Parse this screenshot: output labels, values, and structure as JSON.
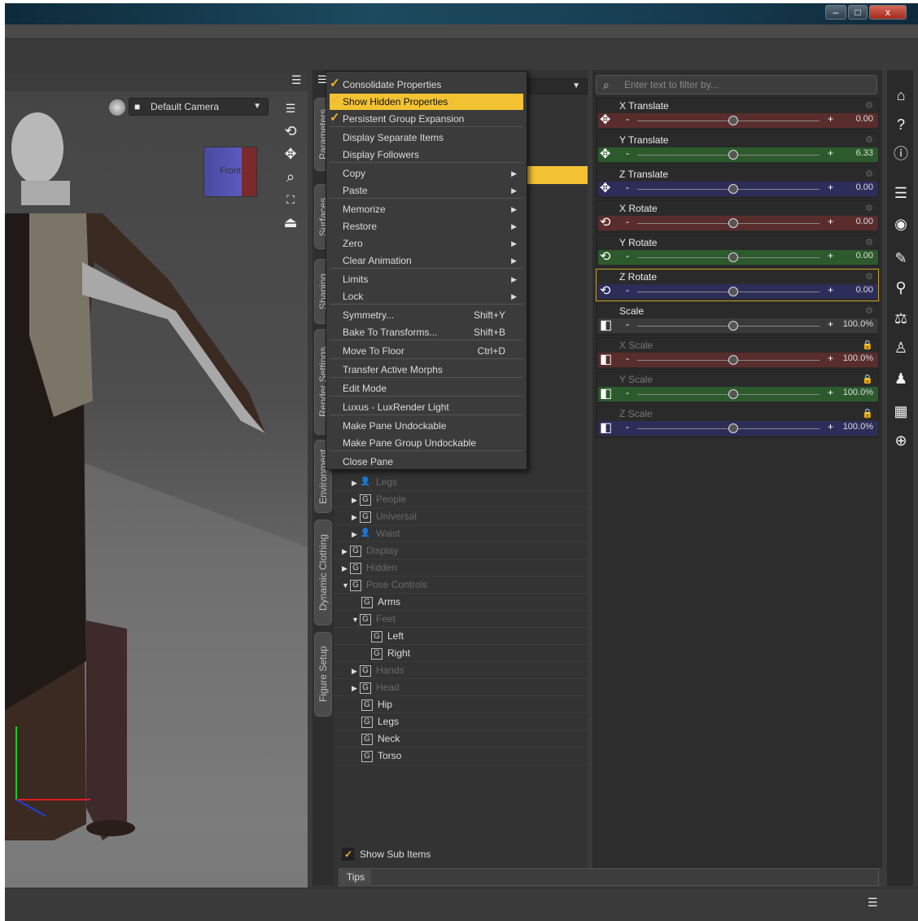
{
  "window": {
    "minimize": "–",
    "maximize": "□",
    "close": "x"
  },
  "viewport": {
    "camera_label": "Default Camera",
    "cube_face": "Front"
  },
  "side_tabs": [
    "Parameters",
    "Surfaces",
    "Shaping",
    "Render Settings",
    "Environment",
    "Dynamic Clothing",
    "Figure Setup"
  ],
  "context_menu": {
    "items": [
      {
        "label": "Consolidate Properties",
        "checked": true
      },
      {
        "label": "Show Hidden Properties",
        "checked": true,
        "highlighted": true
      },
      {
        "label": "Persistent Group Expansion",
        "checked": true
      },
      {
        "label": "Display Separate Items"
      },
      {
        "label": "Display Followers"
      },
      {
        "label": "Copy",
        "submenu": true
      },
      {
        "label": "Paste",
        "submenu": true
      },
      {
        "label": "Memorize",
        "submenu": true
      },
      {
        "label": "Restore",
        "submenu": true
      },
      {
        "label": "Zero",
        "submenu": true
      },
      {
        "label": "Clear Animation",
        "submenu": true
      },
      {
        "label": "Limits",
        "submenu": true
      },
      {
        "label": "Lock",
        "submenu": true
      },
      {
        "label": "Symmetry...",
        "shortcut": "Shift+Y"
      },
      {
        "label": "Bake To Transforms...",
        "shortcut": "Shift+B"
      },
      {
        "label": "Move To Floor",
        "shortcut": "Ctrl+D"
      },
      {
        "label": "Transfer Active Morphs"
      },
      {
        "label": "Edit Mode"
      },
      {
        "label": "Luxus - LuxRender Light"
      },
      {
        "label": "Make Pane Undockable"
      },
      {
        "label": "Make Pane Group Undockable"
      },
      {
        "label": "Close Pane"
      }
    ]
  },
  "tree": {
    "rows": [
      {
        "label": "Legs",
        "dim": true
      },
      {
        "label": "People",
        "dim": true
      },
      {
        "label": "Universal",
        "dim": true
      },
      {
        "label": "Waist",
        "dim": true
      },
      {
        "label": "Display",
        "dim": true
      },
      {
        "label": "Hidden",
        "dim": true
      },
      {
        "label": "Pose Controls",
        "dim": true
      },
      {
        "label": "Arms"
      },
      {
        "label": "Feet",
        "dim": true
      },
      {
        "label": "Left"
      },
      {
        "label": "Right"
      },
      {
        "label": "Hands",
        "dim": true
      },
      {
        "label": "Head",
        "dim": true
      },
      {
        "label": "Hip"
      },
      {
        "label": "Legs"
      },
      {
        "label": "Neck"
      },
      {
        "label": "Torso"
      }
    ],
    "show_sub_items": "Show Sub Items"
  },
  "properties": {
    "filter_placeholder": "Enter text to filter by...",
    "items": [
      {
        "label": "X Translate",
        "value": "0.00",
        "color": "#5a2d2d",
        "dim": false
      },
      {
        "label": "Y Translate",
        "value": "6.33",
        "color": "#2d5a2d",
        "dim": false
      },
      {
        "label": "Z Translate",
        "value": "0.00",
        "color": "#2d2d5a",
        "dim": false
      },
      {
        "label": "X Rotate",
        "value": "0.00",
        "color": "#5a2d2d",
        "dim": false
      },
      {
        "label": "Y Rotate",
        "value": "0.00",
        "color": "#2d5a2d",
        "dim": false
      },
      {
        "label": "Z Rotate",
        "value": "0.00",
        "color": "#2d2d5a",
        "dim": false
      },
      {
        "label": "Scale",
        "value": "100.0%",
        "color": "#3a3a3a",
        "dim": false
      },
      {
        "label": "X Scale",
        "value": "100.0%",
        "color": "#5a2d2d",
        "dim": true
      },
      {
        "label": "Y Scale",
        "value": "100.0%",
        "color": "#2d5a2d",
        "dim": true
      },
      {
        "label": "Z Scale",
        "value": "100.0%",
        "color": "#2d2d5a",
        "dim": true
      }
    ]
  },
  "tips_label": "Tips",
  "colors": {
    "accent": "#f2c232",
    "check": "#f2b52a"
  }
}
